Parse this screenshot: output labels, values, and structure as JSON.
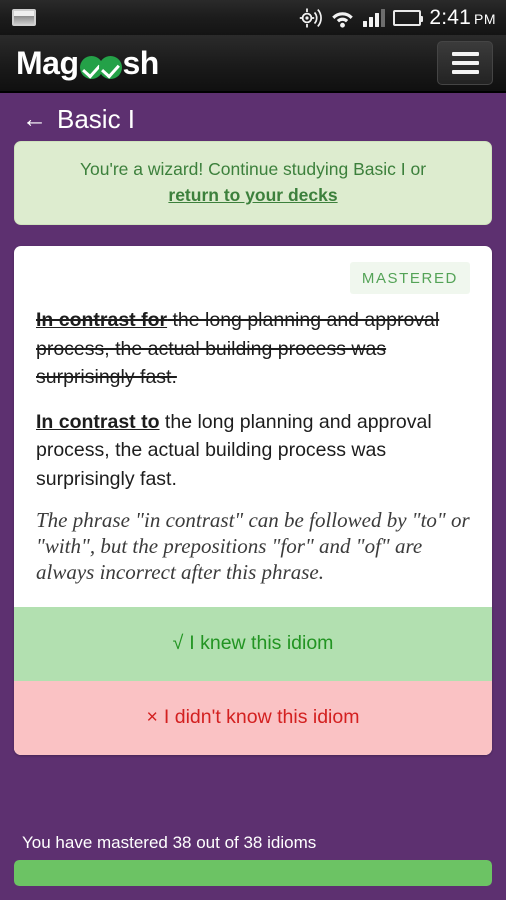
{
  "status_bar": {
    "screenshot_icon": "screenshot-icon",
    "gps_icon": "gps-location-icon",
    "wifi_icon": "wifi-icon",
    "signal_icon": "cellular-signal-icon",
    "battery_icon": "battery-icon",
    "time": "2:41",
    "meridiem": "PM"
  },
  "app_bar": {
    "logo_prefix": "Mag",
    "logo_suffix": "sh",
    "logo_name": "magoosh-logo",
    "menu_icon": "hamburger-menu-icon"
  },
  "page_head": {
    "back_arrow": "←",
    "title": "Basic I"
  },
  "alert": {
    "message": "You're a wizard! Continue studying Basic I or",
    "link_label": "return to your decks"
  },
  "card": {
    "badge": "MASTERED",
    "incorrect_sentence": {
      "key": "In contrast for",
      "rest": " the long planning and approval process, the actual building process was surprisingly fast."
    },
    "correct_sentence": {
      "key": "In contrast to",
      "rest": " the long planning and approval process, the actual building process was surprisingly fast."
    },
    "explanation": "The phrase \"in contrast\" can be followed by \"to\" or \"with\", but the prepositions \"for\" and \"of\" are always incorrect after this phrase.",
    "knew_glyph": "√",
    "knew_label": "I knew this idiom",
    "didnt_glyph": "×",
    "didnt_label": "I didn't know this idiom"
  },
  "progress": {
    "label": "You have mastered 38 out of 38 idioms",
    "mastered": 38,
    "total": 38,
    "percent": 100
  },
  "colors": {
    "purple_background": "#5d3070",
    "alert_background": "#ddeccf",
    "alert_text": "#3c803c",
    "knew_background": "#b2e0b0",
    "knew_text": "#229422",
    "didnt_background": "#fac2c4",
    "didnt_text": "#d32020",
    "progress_fill": "#6cc364",
    "badge_text": "#54a357",
    "logo_check": "#24a148"
  }
}
